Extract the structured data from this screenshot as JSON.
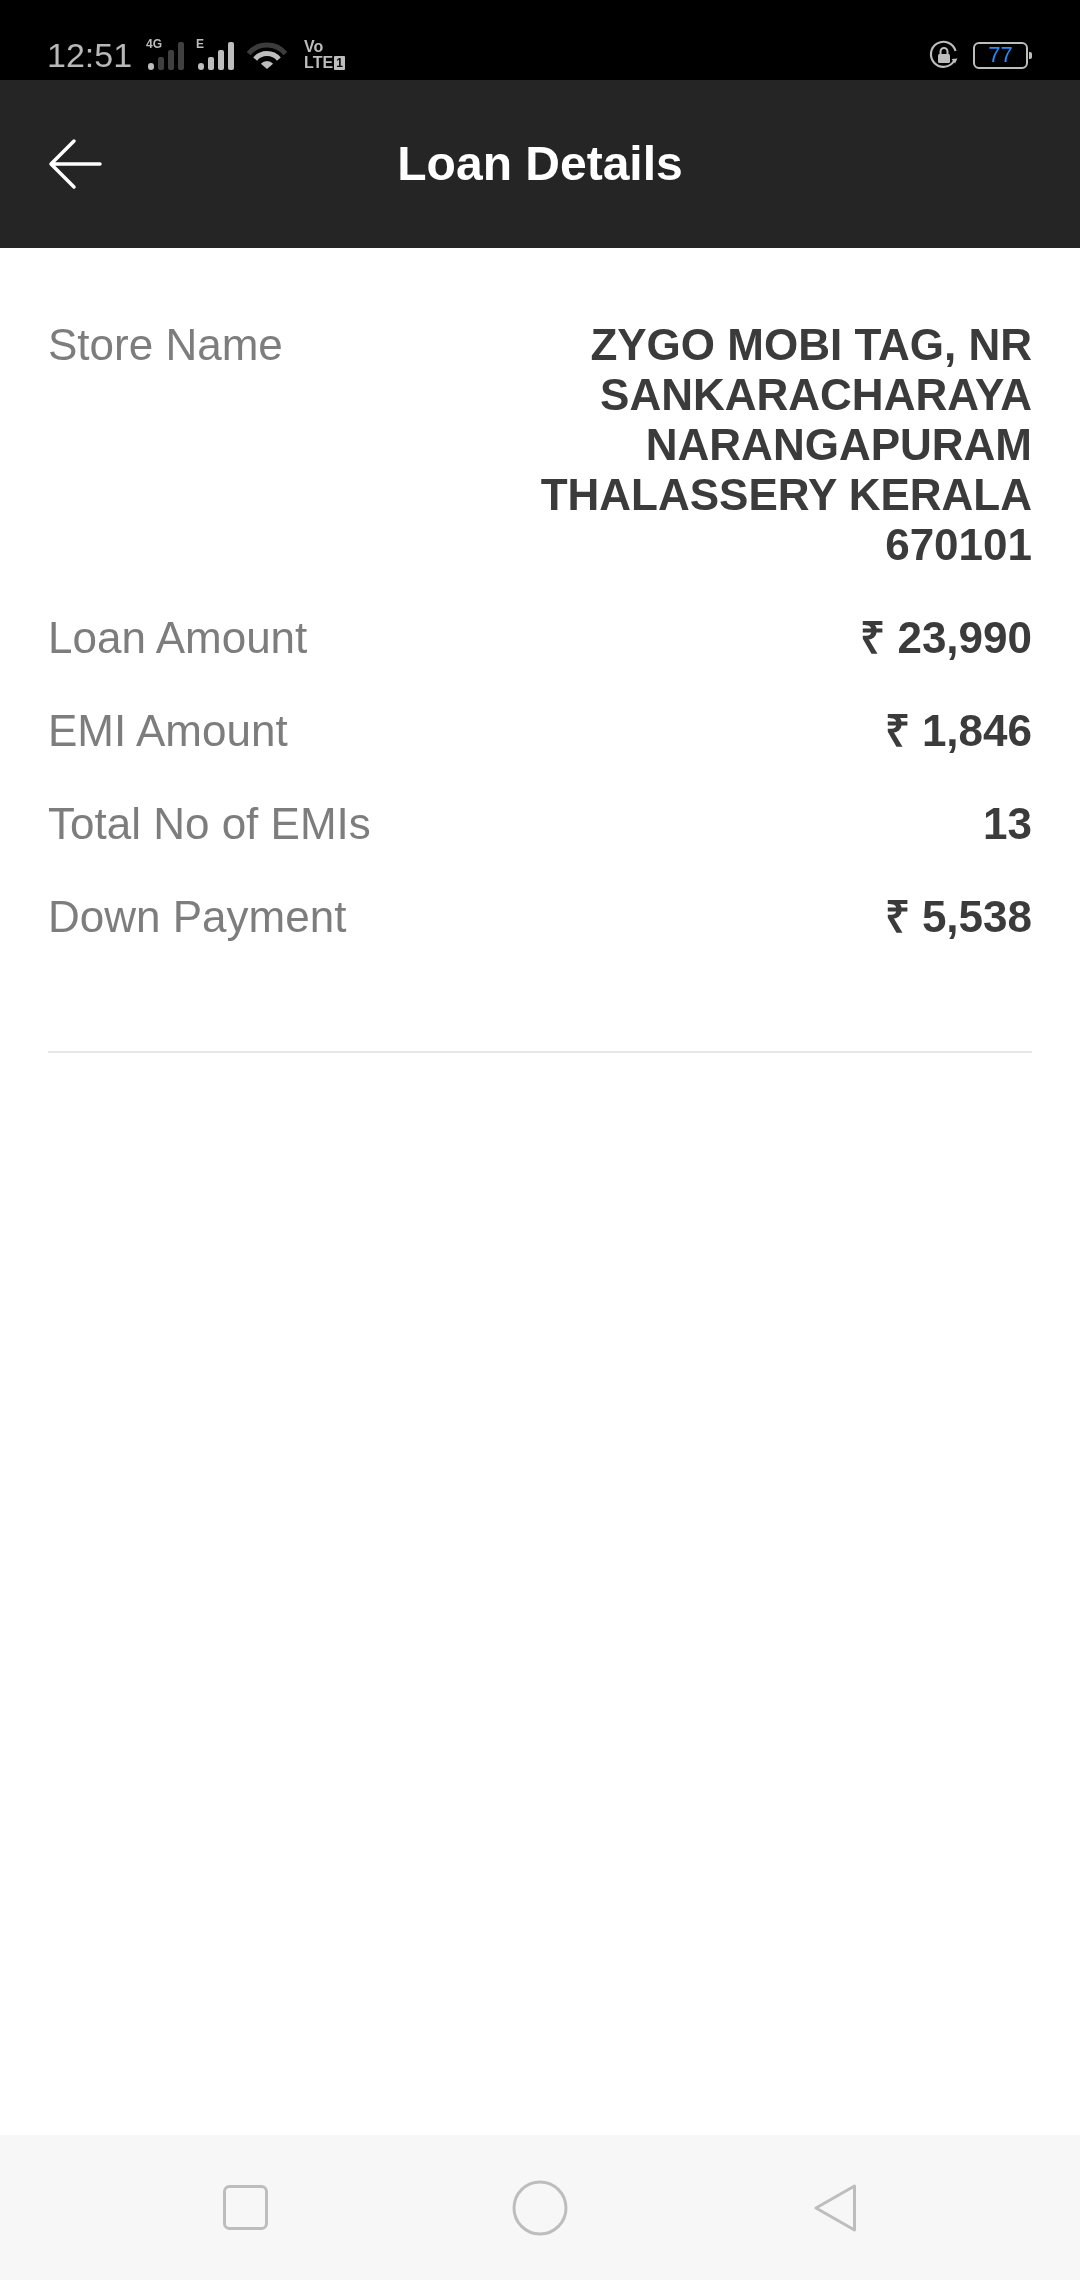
{
  "status_bar": {
    "time": "12:51",
    "sim1_network": "4G",
    "sim2_network": "E",
    "volte": {
      "top": "Vo",
      "bottom": "LTE",
      "sim": "1"
    },
    "battery": "77"
  },
  "app_bar": {
    "title": "Loan Details"
  },
  "details": [
    {
      "label": "Store Name",
      "value": "ZYGO MOBI TAG, NR SANKARACHARAYA NARANGAPURAM THALASSERY KERALA 670101"
    },
    {
      "label": "Loan Amount",
      "value": "₹ 23,990"
    },
    {
      "label": "EMI Amount",
      "value": "₹ 1,846"
    },
    {
      "label": "Total No of EMIs",
      "value": "13"
    },
    {
      "label": "Down Payment",
      "value": "₹ 5,538"
    }
  ]
}
